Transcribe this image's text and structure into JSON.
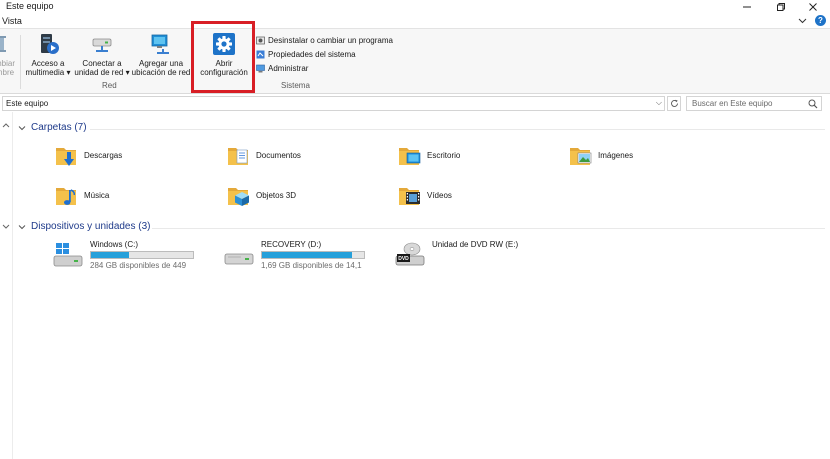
{
  "window": {
    "title": "Este equipo"
  },
  "menu": {
    "view_tab": "Vista"
  },
  "ribbon": {
    "partial_button": {
      "line1": "mbiar",
      "line2": "mbre"
    },
    "media_access": {
      "line1": "Acceso a",
      "line2": "multimedia"
    },
    "map_drive": {
      "line1": "Conectar a",
      "line2": "unidad de red"
    },
    "add_location": {
      "line1": "Agregar una",
      "line2": "ubicación de red"
    },
    "open_settings": {
      "line1": "Abrir",
      "line2": "configuración"
    },
    "uninstall": "Desinstalar o cambiar un programa",
    "system_properties": "Propiedades del sistema",
    "manage": "Administrar",
    "group_network": "Red",
    "group_system": "Sistema"
  },
  "address": {
    "path": "Este equipo",
    "search_placeholder": "Buscar en Este equipo"
  },
  "folders": {
    "header": "Carpetas (7)",
    "items": [
      {
        "name": "Descargas",
        "icon": "downloads-folder-icon"
      },
      {
        "name": "Documentos",
        "icon": "documents-folder-icon"
      },
      {
        "name": "Escritorio",
        "icon": "desktop-folder-icon"
      },
      {
        "name": "Imágenes",
        "icon": "pictures-folder-icon"
      },
      {
        "name": "Música",
        "icon": "music-folder-icon"
      },
      {
        "name": "Objetos 3D",
        "icon": "3d-objects-folder-icon"
      },
      {
        "name": "Vídeos",
        "icon": "videos-folder-icon"
      }
    ]
  },
  "drives": {
    "header": "Dispositivos y unidades (3)",
    "items": [
      {
        "name": "Windows (C:)",
        "free_text": "284 GB disponibles de 449",
        "used_fraction": 0.37,
        "icon": "windows-drive-icon"
      },
      {
        "name": "RECOVERY (D:)",
        "free_text": "1,69 GB disponibles de 14,1",
        "used_fraction": 0.88,
        "icon": "hard-drive-icon"
      },
      {
        "name": "Unidad de DVD RW (E:)",
        "icon": "dvd-drive-icon"
      }
    ]
  },
  "colors": {
    "accent": "#1e73c8",
    "section_header": "#1e3a8a",
    "drive_bar": "#26a0da",
    "highlight_box": "#d81e25",
    "folder_yellow": "#f4c14b"
  }
}
